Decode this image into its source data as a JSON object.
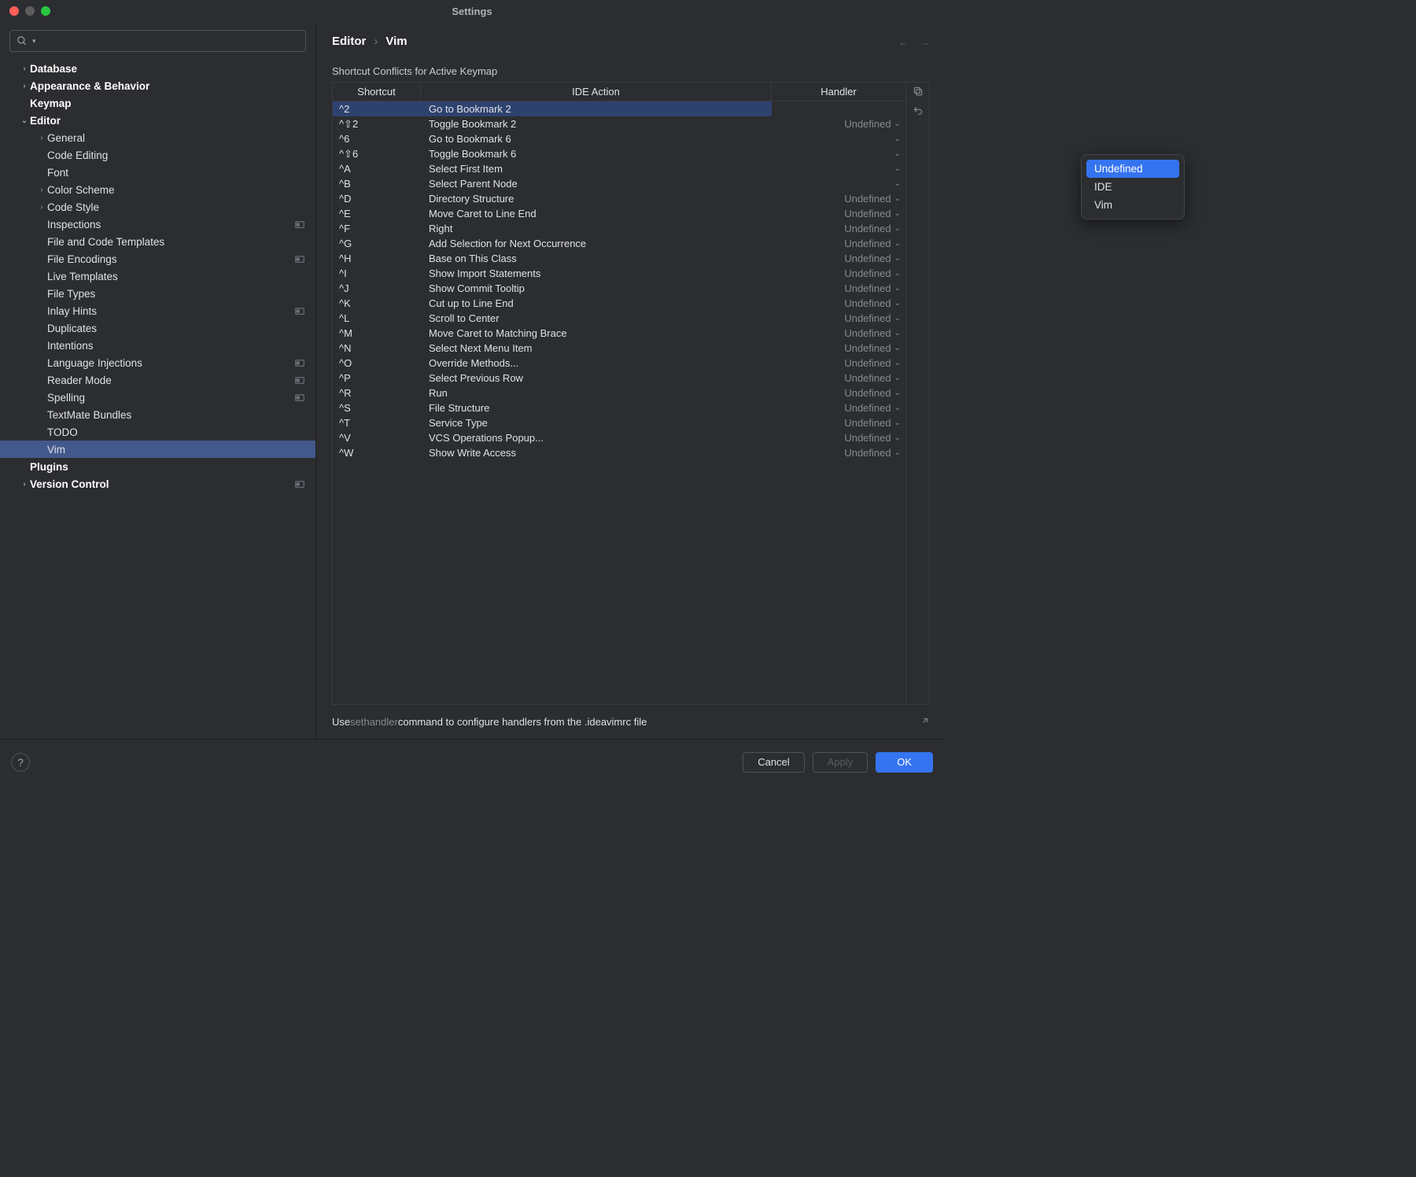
{
  "window_title": "Settings",
  "search_placeholder": "",
  "sidebar": [
    {
      "label": "Database",
      "level": 0,
      "bold": true,
      "chevron": ">",
      "banner": false
    },
    {
      "label": "Appearance & Behavior",
      "level": 0,
      "bold": true,
      "chevron": ">",
      "banner": false
    },
    {
      "label": "Keymap",
      "level": 0,
      "bold": true,
      "chevron": "",
      "banner": false
    },
    {
      "label": "Editor",
      "level": 0,
      "bold": true,
      "chevron": "v",
      "banner": false
    },
    {
      "label": "General",
      "level": 1,
      "bold": false,
      "chevron": ">",
      "banner": false
    },
    {
      "label": "Code Editing",
      "level": 1,
      "bold": false,
      "chevron": "",
      "banner": false
    },
    {
      "label": "Font",
      "level": 1,
      "bold": false,
      "chevron": "",
      "banner": false
    },
    {
      "label": "Color Scheme",
      "level": 1,
      "bold": false,
      "chevron": ">",
      "banner": false
    },
    {
      "label": "Code Style",
      "level": 1,
      "bold": false,
      "chevron": ">",
      "banner": false
    },
    {
      "label": "Inspections",
      "level": 1,
      "bold": false,
      "chevron": "",
      "banner": true
    },
    {
      "label": "File and Code Templates",
      "level": 1,
      "bold": false,
      "chevron": "",
      "banner": false
    },
    {
      "label": "File Encodings",
      "level": 1,
      "bold": false,
      "chevron": "",
      "banner": true
    },
    {
      "label": "Live Templates",
      "level": 1,
      "bold": false,
      "chevron": "",
      "banner": false
    },
    {
      "label": "File Types",
      "level": 1,
      "bold": false,
      "chevron": "",
      "banner": false
    },
    {
      "label": "Inlay Hints",
      "level": 1,
      "bold": false,
      "chevron": "",
      "banner": true
    },
    {
      "label": "Duplicates",
      "level": 1,
      "bold": false,
      "chevron": "",
      "banner": false
    },
    {
      "label": "Intentions",
      "level": 1,
      "bold": false,
      "chevron": "",
      "banner": false
    },
    {
      "label": "Language Injections",
      "level": 1,
      "bold": false,
      "chevron": "",
      "banner": true
    },
    {
      "label": "Reader Mode",
      "level": 1,
      "bold": false,
      "chevron": "",
      "banner": true
    },
    {
      "label": "Spelling",
      "level": 1,
      "bold": false,
      "chevron": "",
      "banner": true
    },
    {
      "label": "TextMate Bundles",
      "level": 1,
      "bold": false,
      "chevron": "",
      "banner": false
    },
    {
      "label": "TODO",
      "level": 1,
      "bold": false,
      "chevron": "",
      "banner": false
    },
    {
      "label": "Vim",
      "level": 1,
      "bold": false,
      "chevron": "",
      "banner": false,
      "selected": true
    },
    {
      "label": "Plugins",
      "level": 0,
      "bold": true,
      "chevron": "",
      "banner": false
    },
    {
      "label": "Version Control",
      "level": 0,
      "bold": true,
      "chevron": ">",
      "banner": true
    }
  ],
  "breadcrumb": {
    "a": "Editor",
    "b": "Vim"
  },
  "section_title": "Shortcut Conflicts for Active Keymap",
  "columns": {
    "shortcut": "Shortcut",
    "action": "IDE Action",
    "handler": "Handler"
  },
  "rows": [
    {
      "shortcut": "^2",
      "action": "Go to Bookmark 2",
      "handler": "",
      "selected": true
    },
    {
      "shortcut": "^⇧2",
      "action": "Toggle Bookmark 2",
      "handler": "Undefined"
    },
    {
      "shortcut": "^6",
      "action": "Go to Bookmark 6",
      "handler": ""
    },
    {
      "shortcut": "^⇧6",
      "action": "Toggle Bookmark 6",
      "handler": ""
    },
    {
      "shortcut": "^A",
      "action": "Select First Item",
      "handler": ""
    },
    {
      "shortcut": "^B",
      "action": "Select Parent Node",
      "handler": ""
    },
    {
      "shortcut": "^D",
      "action": "Directory Structure",
      "handler": "Undefined"
    },
    {
      "shortcut": "^E",
      "action": "Move Caret to Line End",
      "handler": "Undefined"
    },
    {
      "shortcut": "^F",
      "action": "Right",
      "handler": "Undefined"
    },
    {
      "shortcut": "^G",
      "action": "Add Selection for Next Occurrence",
      "handler": "Undefined"
    },
    {
      "shortcut": "^H",
      "action": "Base on This Class",
      "handler": "Undefined"
    },
    {
      "shortcut": "^I",
      "action": "Show Import Statements",
      "handler": "Undefined"
    },
    {
      "shortcut": "^J",
      "action": "Show Commit Tooltip",
      "handler": "Undefined"
    },
    {
      "shortcut": "^K",
      "action": "Cut up to Line End",
      "handler": "Undefined"
    },
    {
      "shortcut": "^L",
      "action": "Scroll to Center",
      "handler": "Undefined"
    },
    {
      "shortcut": "^M",
      "action": "Move Caret to Matching Brace",
      "handler": "Undefined"
    },
    {
      "shortcut": "^N",
      "action": "Select Next Menu Item",
      "handler": "Undefined"
    },
    {
      "shortcut": "^O",
      "action": "Override Methods...",
      "handler": "Undefined"
    },
    {
      "shortcut": "^P",
      "action": "Select Previous Row",
      "handler": "Undefined"
    },
    {
      "shortcut": "^R",
      "action": "Run",
      "handler": "Undefined"
    },
    {
      "shortcut": "^S",
      "action": "File Structure",
      "handler": "Undefined"
    },
    {
      "shortcut": "^T",
      "action": "Service Type",
      "handler": "Undefined"
    },
    {
      "shortcut": "^V",
      "action": "VCS Operations Popup...",
      "handler": "Undefined"
    },
    {
      "shortcut": "^W",
      "action": "Show Write Access",
      "handler": "Undefined"
    }
  ],
  "popup": [
    "Undefined",
    "IDE",
    "Vim"
  ],
  "footer_note": {
    "pre": "Use ",
    "cmd": "sethandler",
    "post": " command to configure handlers from the .ideavimrc file"
  },
  "buttons": {
    "cancel": "Cancel",
    "apply": "Apply",
    "ok": "OK"
  }
}
